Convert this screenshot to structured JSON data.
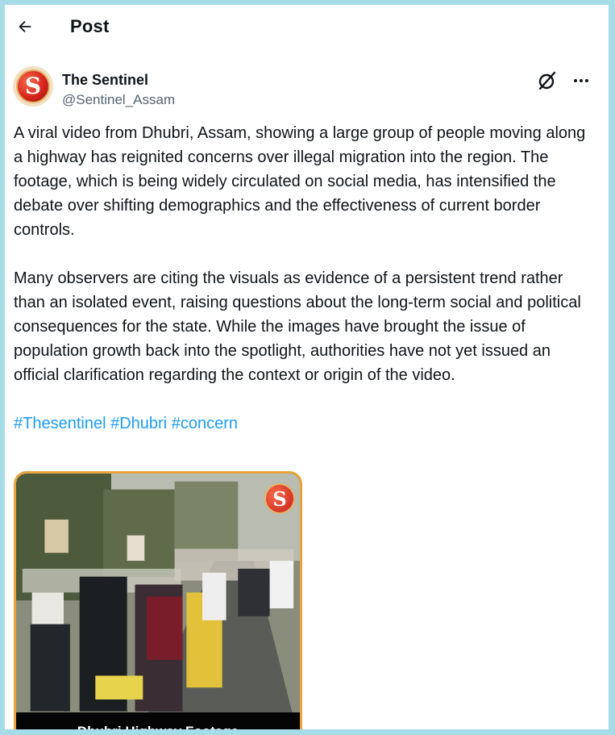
{
  "header": {
    "back_icon": "arrow-left-icon",
    "title": "Post"
  },
  "author": {
    "avatar_letter": "S",
    "display_name": "The Sentinel",
    "handle": "@Sentinel_Assam",
    "grok_icon": "grok-icon",
    "more_icon": "more-horizontal-icon"
  },
  "tweet": {
    "paragraphs": [
      "A viral video from Dhubri, Assam, showing a large group of people moving along a highway has reignited concerns over illegal migration into the region. The footage, which is being widely circulated on social media, has intensified the debate over shifting demographics and the effectiveness of current border controls.",
      "Many observers are citing the visuals as evidence of a persistent trend rather than an isolated event, raising questions about the long-term social and political consequences for the state. While the images have brought the issue of population growth back into the spotlight, authorities have not yet issued an official clarification regarding the context or origin of the video."
    ],
    "hashtags": [
      "#Thesentinel",
      "#Dhubri",
      "#concern"
    ]
  },
  "media": {
    "logo_letter": "S",
    "caption": "Dhubri Highway Footage"
  },
  "colors": {
    "link": "#1d9bf0",
    "text": "#0f1419",
    "secondary": "#536471",
    "media_border": "#e8a33d",
    "page_background": "#a6dbe8"
  }
}
